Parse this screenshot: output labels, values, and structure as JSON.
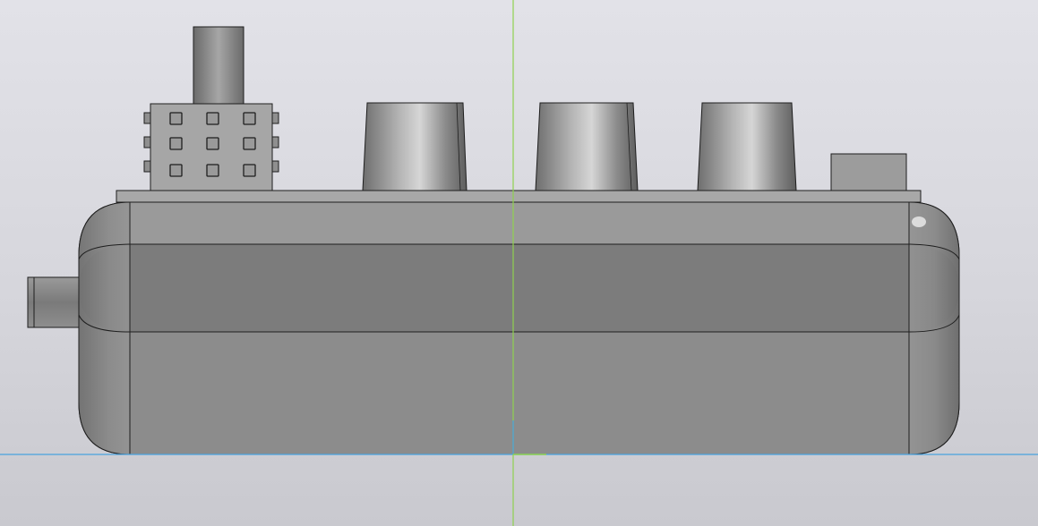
{
  "viewport": {
    "background_top": "#e2e2e8",
    "background_bottom": "#c9c9cf"
  },
  "model": {
    "body_color": "#8c8c8c",
    "top_band_color": "#9a9a9a",
    "mid_band_color": "#7c7c7c",
    "plate_color": "#a8a8a8",
    "edge_color": "#1e1e1e",
    "parts": [
      "base-housing",
      "top-plate",
      "connector-block",
      "vertical-shaft",
      "knob-1",
      "knob-2",
      "knob-3",
      "small-block",
      "side-connector"
    ]
  },
  "axes": {
    "vertical_axis_color": "#8fd14f",
    "horizontal_axis_color": "#4aa3df"
  }
}
